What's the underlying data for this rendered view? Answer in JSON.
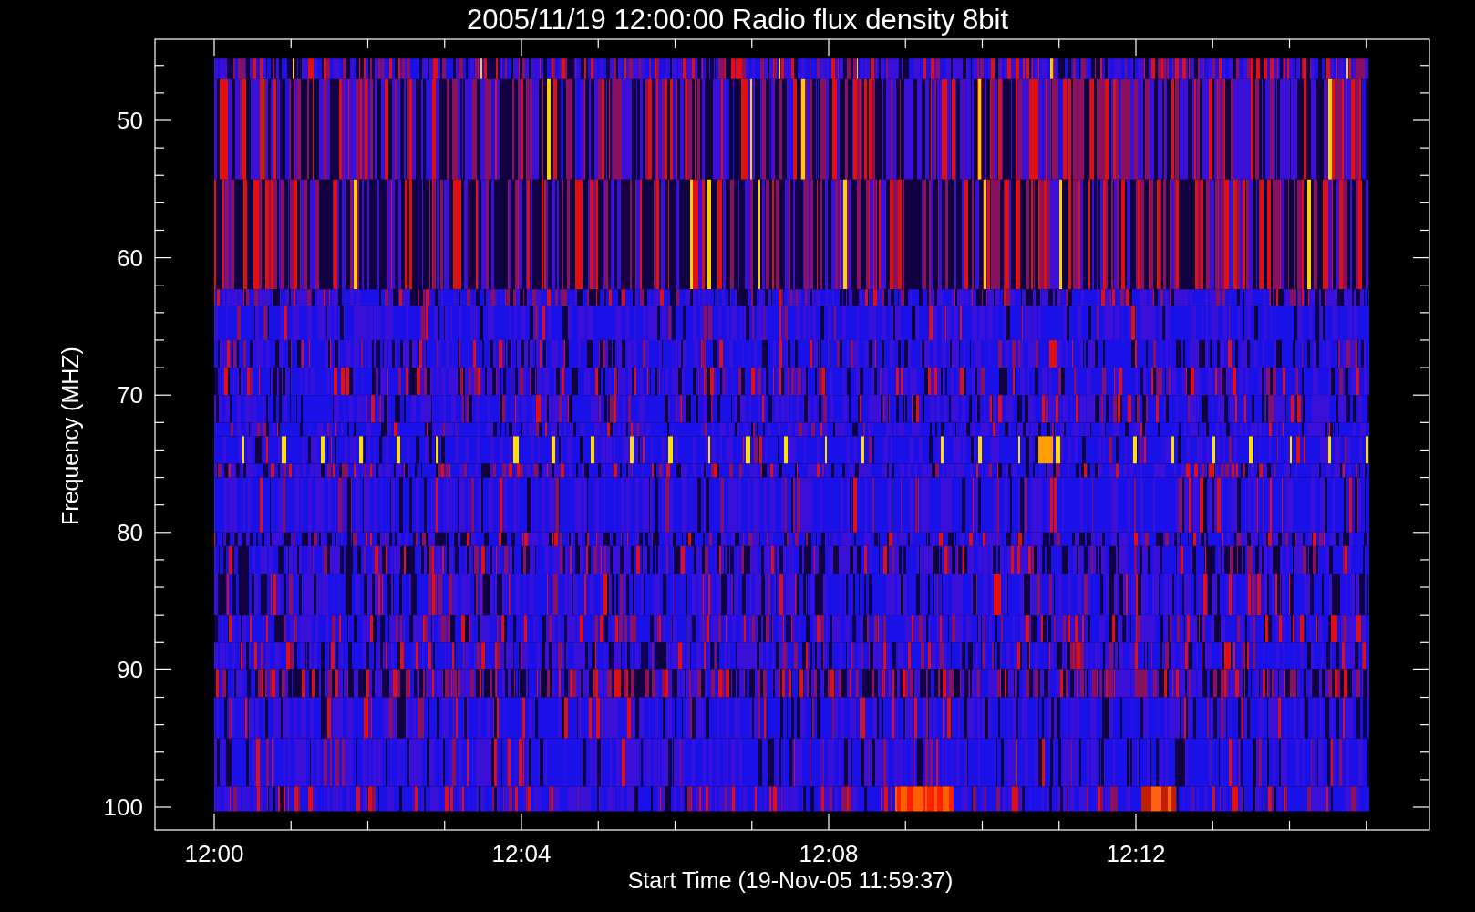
{
  "title": "2005/11/19 12:00:00 Radio flux density 8bit",
  "y_axis": {
    "label": "Frequency (MHZ)",
    "ticks": [
      "50",
      "60",
      "70",
      "80",
      "90",
      "100"
    ]
  },
  "x_axis": {
    "label": "Start Time (19-Nov-05 11:59:37)",
    "ticks": [
      "12:00",
      "12:04",
      "12:08",
      "12:12"
    ]
  }
}
